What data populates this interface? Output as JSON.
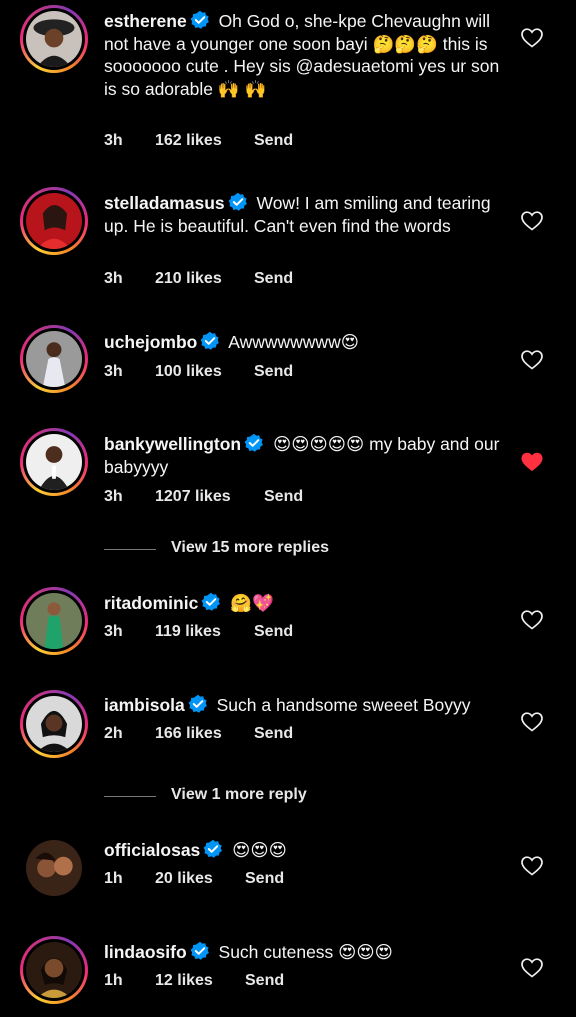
{
  "comments": [
    {
      "username": "estherene",
      "verified": true,
      "text": "Oh God o, she-kpe Chevaughn will not have a younger one soon bayi 🤔🤔🤔 this is sooooooo cute . Hey sis @adesuaetomi yes ur son is so adorable 🙌 🙌",
      "time": "3h",
      "likes": "162 likes",
      "reply": "Send",
      "liked": false
    },
    {
      "username": "stelladamasus",
      "verified": true,
      "text": "Wow! I am smiling and tearing up. He is beautiful. Can't even find the words",
      "time": "3h",
      "likes": "210 likes",
      "reply": "Send",
      "liked": false
    },
    {
      "username": "uchejombo",
      "verified": true,
      "text": "Awwwwwwww😍",
      "time": "3h",
      "likes": "100 likes",
      "reply": "Send",
      "liked": false
    },
    {
      "username": "bankywellington",
      "verified": true,
      "text": "😍😍😍😍😍 my baby and our babyyyy",
      "time": "3h",
      "likes": "1207 likes",
      "reply": "Send",
      "liked": true
    },
    {
      "username": "ritadominic",
      "verified": true,
      "text": "🤗💖",
      "time": "3h",
      "likes": "119 likes",
      "reply": "Send",
      "liked": false
    },
    {
      "username": "iambisola",
      "verified": true,
      "text": "Such a handsome sweeet Boyyy",
      "time": "2h",
      "likes": "166 likes",
      "reply": "Send",
      "liked": false
    },
    {
      "username": "officialosas",
      "verified": true,
      "text": "😍😍😍",
      "time": "1h",
      "likes": "20 likes",
      "reply": "Send",
      "liked": false
    },
    {
      "username": "lindaosifo",
      "verified": true,
      "text": "Such cuteness 😍😍😍",
      "time": "1h",
      "likes": "12 likes",
      "reply": "Send",
      "liked": false
    }
  ],
  "view_replies": [
    {
      "label": "View 15 more replies"
    },
    {
      "label": "View 1 more reply"
    }
  ],
  "colors": {
    "heart_liked": "#ff3040",
    "verified": "#0095f6",
    "background": "#000000"
  },
  "icons": {
    "verified": "verified-badge-icon",
    "like": "heart-icon"
  }
}
